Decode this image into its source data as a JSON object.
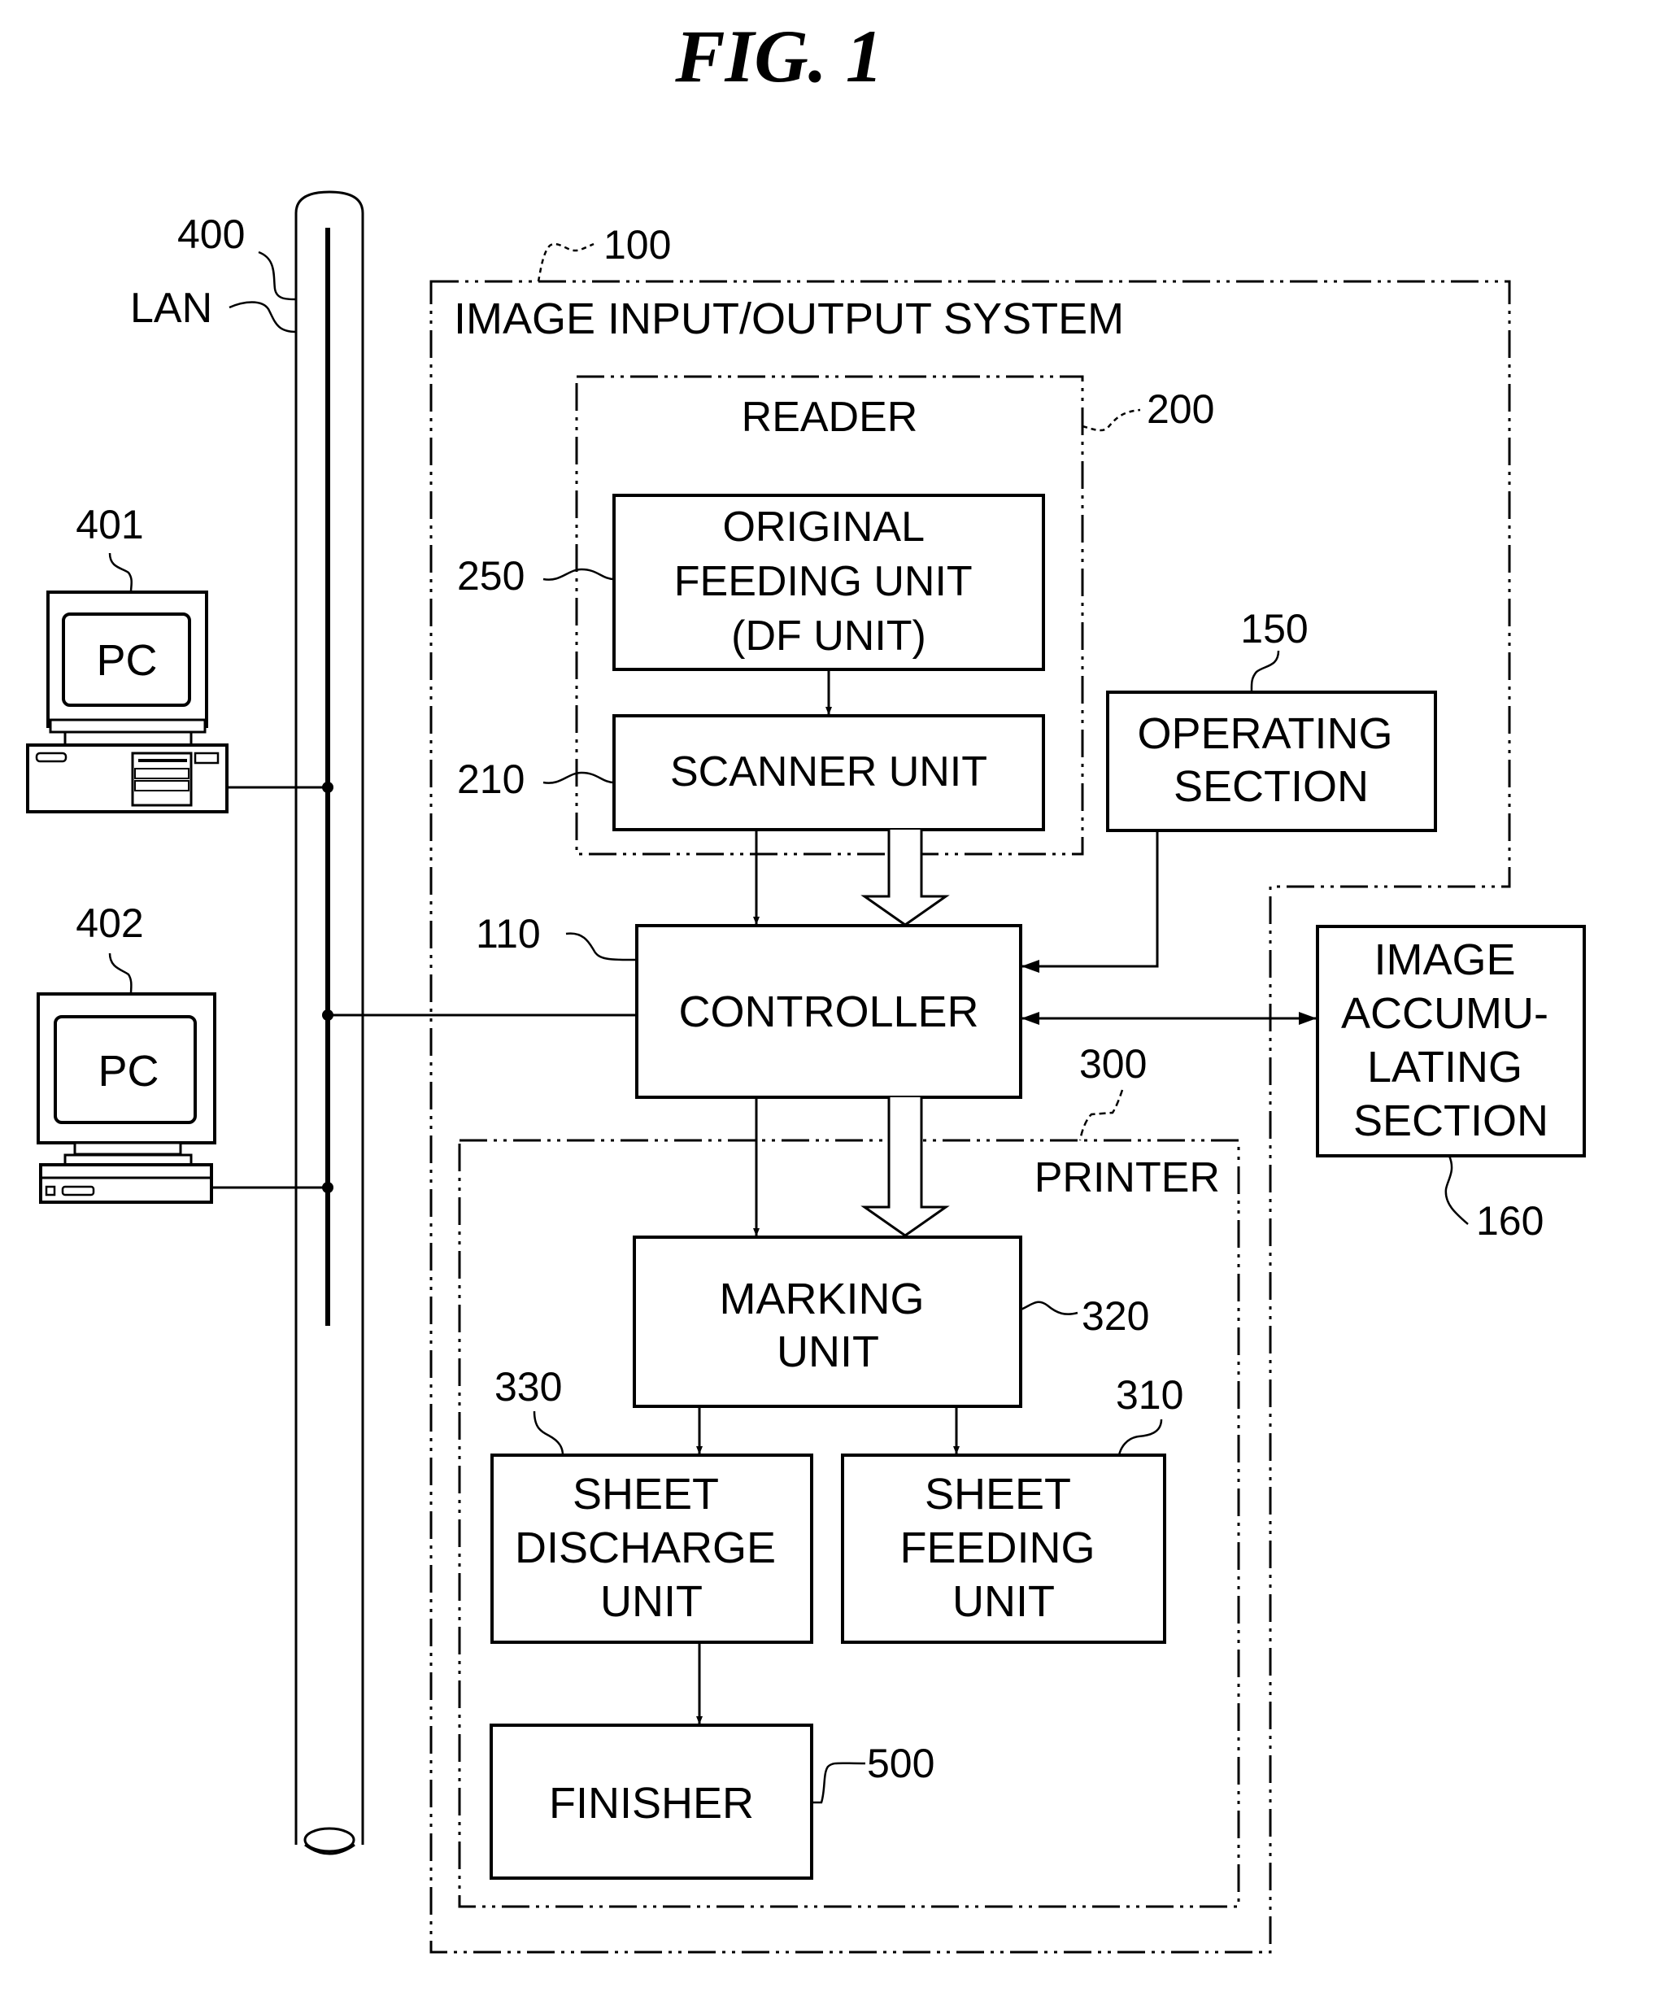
{
  "figure": {
    "title": "FIG. 1"
  },
  "network": {
    "name": "LAN",
    "ref": "400",
    "pcs": [
      {
        "ref": "401",
        "label": "PC"
      },
      {
        "ref": "402",
        "label": "PC"
      }
    ]
  },
  "system": {
    "ref": "100",
    "label": "IMAGE INPUT/OUTPUT SYSTEM"
  },
  "reader": {
    "ref": "200",
    "label": "READER",
    "units": {
      "original_feeding": {
        "ref": "250",
        "lines": [
          "ORIGINAL",
          "FEEDING UNIT",
          "(DF UNIT)"
        ]
      },
      "scanner": {
        "ref": "210",
        "lines": [
          "SCANNER UNIT"
        ]
      }
    }
  },
  "operating_section": {
    "ref": "150",
    "lines": [
      "OPERATING",
      "SECTION"
    ]
  },
  "controller": {
    "ref": "110",
    "lines": [
      "CONTROLLER"
    ]
  },
  "image_accumulating_section": {
    "ref": "160",
    "lines": [
      "IMAGE",
      "ACCUMU-",
      "LATING",
      "SECTION"
    ]
  },
  "printer": {
    "ref": "300",
    "label": "PRINTER",
    "units": {
      "marking": {
        "ref": "320",
        "lines": [
          "MARKING",
          "UNIT"
        ]
      },
      "sheet_discharge": {
        "ref": "330",
        "lines": [
          "SHEET",
          "DISCHARGE",
          "UNIT"
        ]
      },
      "sheet_feeding": {
        "ref": "310",
        "lines": [
          "SHEET",
          "FEEDING",
          "UNIT"
        ]
      }
    }
  },
  "finisher": {
    "ref": "500",
    "lines": [
      "FINISHER"
    ]
  }
}
